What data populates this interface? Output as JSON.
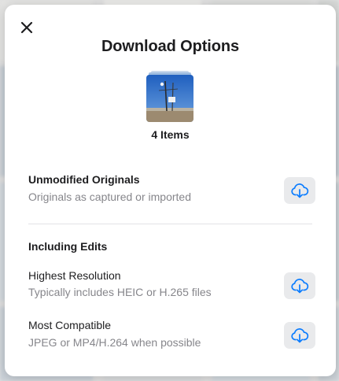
{
  "dialog": {
    "title": "Download Options",
    "items_count": "4 Items"
  },
  "options": {
    "originals": {
      "title": "Unmodified Originals",
      "subtitle": "Originals as captured or imported"
    },
    "edits_section": "Including Edits",
    "highest": {
      "title": "Highest Resolution",
      "subtitle": "Typically includes HEIC or H.265 files"
    },
    "compatible": {
      "title": "Most Compatible",
      "subtitle": "JPEG or MP4/H.264 when possible"
    }
  },
  "icons": {
    "close": "close-icon",
    "download": "cloud-download-icon"
  },
  "colors": {
    "accent": "#0a7cff",
    "button_bg": "#e9eaec",
    "title_text": "#1d1d1f",
    "secondary_text": "#86868b"
  }
}
